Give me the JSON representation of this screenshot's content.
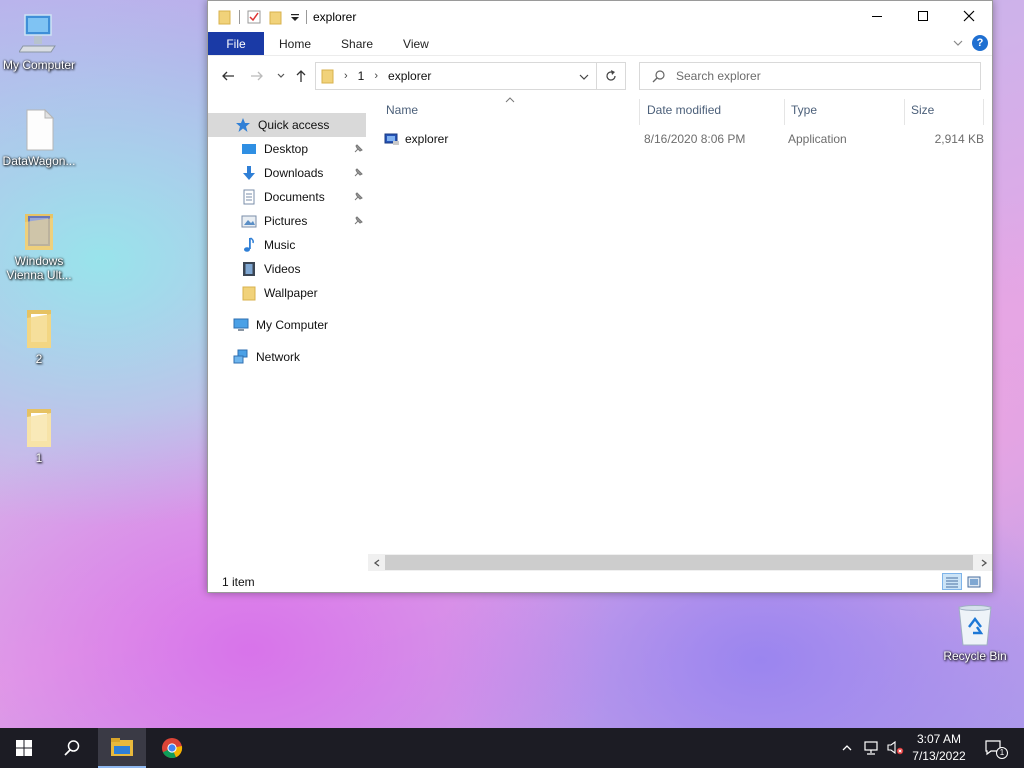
{
  "desktop": {
    "icons": [
      {
        "label": "My Computer",
        "icon": "monitor-icon"
      },
      {
        "label": "DataWagon...",
        "icon": "blank-file-icon"
      },
      {
        "label": "Windows Vienna Ult...",
        "icon": "folder-icon"
      },
      {
        "label": "2",
        "icon": "folder-icon"
      },
      {
        "label": "1",
        "icon": "folder-icon"
      },
      {
        "label": "Recycle Bin",
        "icon": "recycle-bin-icon"
      }
    ]
  },
  "window": {
    "title": "explorer",
    "ribbon_tabs": [
      "File",
      "Home",
      "Share",
      "View"
    ],
    "address": {
      "crumbs": [
        "1",
        "explorer"
      ]
    },
    "search": {
      "placeholder": "Search explorer"
    },
    "nav_pane": {
      "quick_access": "Quick access",
      "pinned": [
        "Desktop",
        "Downloads",
        "Documents",
        "Pictures"
      ],
      "unpinned": [
        "Music",
        "Videos",
        "Wallpaper"
      ],
      "my_computer": "My Computer",
      "network": "Network"
    },
    "columns": [
      "Name",
      "Date modified",
      "Type",
      "Size"
    ],
    "files": [
      {
        "name": "explorer",
        "date_modified": "8/16/2020 8:06 PM",
        "type": "Application",
        "size": "2,914 KB"
      }
    ],
    "status": "1 item"
  },
  "taskbar": {
    "clock": {
      "time": "3:07 AM",
      "date": "7/13/2022"
    },
    "notification_count": "1"
  },
  "colors": {
    "file_tab": "#1a3aa6",
    "selected_nav": "#d9d9d9",
    "taskbar": "#1c1c24",
    "column_header_text": "#4c607a"
  }
}
